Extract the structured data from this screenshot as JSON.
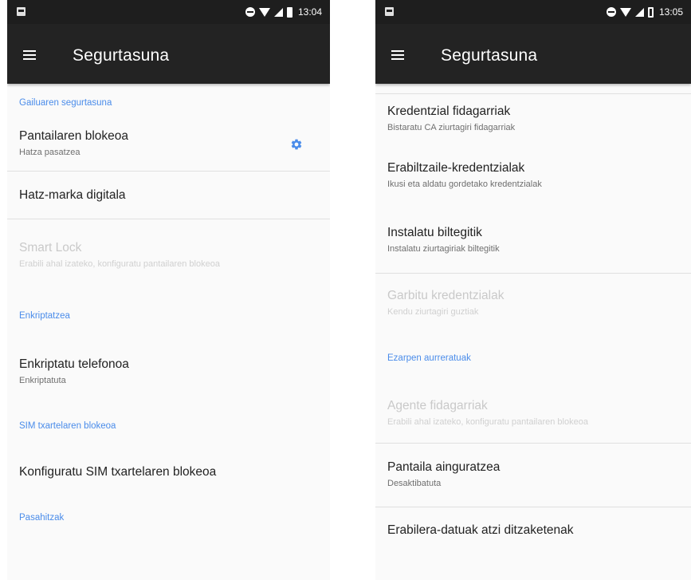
{
  "left": {
    "status": {
      "time": "13:04",
      "battery": "full"
    },
    "toolbar": {
      "title": "Segurtasuna"
    },
    "items": [
      {
        "kind": "header",
        "title": "Gailuaren segurtasuna"
      },
      {
        "kind": "pref",
        "title": "Pantailaren blokeoa",
        "summary": "Hatza pasatzea",
        "icon": "gear-icon"
      },
      {
        "kind": "divider"
      },
      {
        "kind": "pref",
        "title": "Hatz-marka digitala"
      },
      {
        "kind": "divider"
      },
      {
        "kind": "pref",
        "title": "Smart Lock",
        "summary": "Erabili ahal izateko, konfiguratu pantailaren blokeoa",
        "disabled": true
      },
      {
        "kind": "header",
        "title": "Enkriptatzea"
      },
      {
        "kind": "pref",
        "title": "Enkriptatu telefonoa",
        "summary": "Enkriptatuta"
      },
      {
        "kind": "header",
        "title": "SIM txartelaren blokeoa"
      },
      {
        "kind": "pref",
        "title": "Konfiguratu SIM txartelaren blokeoa"
      },
      {
        "kind": "header",
        "title": "Pasahitzak"
      }
    ]
  },
  "right": {
    "status": {
      "time": "13:05",
      "battery": "outline"
    },
    "toolbar": {
      "title": "Segurtasuna"
    },
    "items": [
      {
        "kind": "divider"
      },
      {
        "kind": "pref",
        "title": "Kredentzial fidagarriak",
        "summary": "Bistaratu CA ziurtagiri fidagarriak"
      },
      {
        "kind": "pref",
        "title": "Erabiltzaile-kredentzialak",
        "summary": "Ikusi eta aldatu gordetako kredentzialak"
      },
      {
        "kind": "pref",
        "title": "Instalatu biltegitik",
        "summary": "Instalatu ziurtagiriak biltegitik"
      },
      {
        "kind": "divider"
      },
      {
        "kind": "pref",
        "title": "Garbitu kredentzialak",
        "summary": "Kendu ziurtagiri guztiak",
        "disabled": true
      },
      {
        "kind": "header",
        "title": "Ezarpen aurreratuak"
      },
      {
        "kind": "pref",
        "title": "Agente fidagarriak",
        "summary": "Erabili ahal izateko, konfiguratu pantailaren blokeoa",
        "disabled": true
      },
      {
        "kind": "divider"
      },
      {
        "kind": "pref",
        "title": "Pantaila ainguratzea",
        "summary": "Desaktibatuta"
      },
      {
        "kind": "divider"
      },
      {
        "kind": "pref",
        "title": "Erabilera-datuak atzi ditzaketenak"
      }
    ]
  },
  "colors": {
    "accent": "#4a8cea",
    "toolbar": "#232323",
    "statusbar": "#1e1e1e",
    "background": "#fafafa"
  }
}
